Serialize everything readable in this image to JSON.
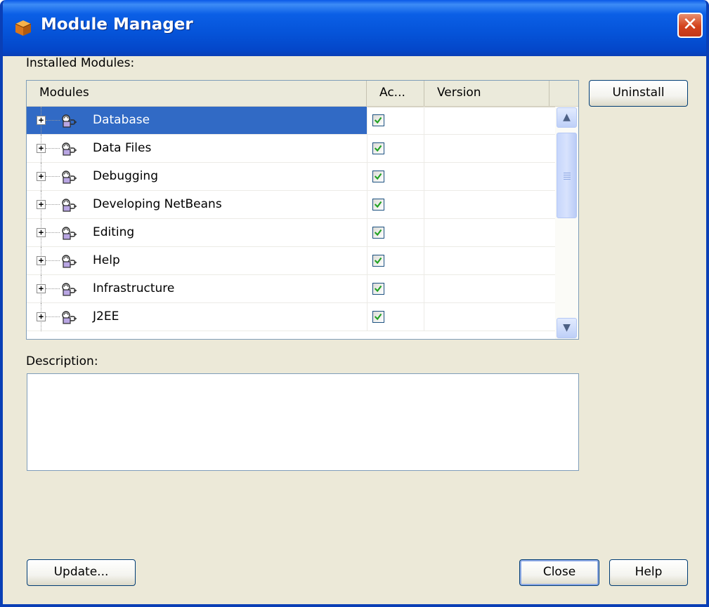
{
  "window": {
    "title": "Module Manager",
    "close_glyph": "✕",
    "icon": "netbeans-cube-icon"
  },
  "installed_label": "Installed Modules:",
  "table": {
    "columns": [
      "Modules",
      "Ac...",
      "Version"
    ],
    "rows": [
      {
        "name": "Database",
        "active": true,
        "version": "",
        "selected": true
      },
      {
        "name": "Data Files",
        "active": true,
        "version": ""
      },
      {
        "name": "Debugging",
        "active": true,
        "version": ""
      },
      {
        "name": "Developing NetBeans",
        "active": true,
        "version": ""
      },
      {
        "name": "Editing",
        "active": true,
        "version": ""
      },
      {
        "name": "Help",
        "active": true,
        "version": ""
      },
      {
        "name": "Infrastructure",
        "active": true,
        "version": ""
      },
      {
        "name": "J2EE",
        "active": true,
        "version": ""
      }
    ]
  },
  "description": {
    "label": "Description:",
    "value": ""
  },
  "buttons": {
    "uninstall": "Uninstall",
    "update": "Update...",
    "close": "Close",
    "help": "Help"
  },
  "colors": {
    "selection": "#316ac5",
    "title_bar": "#0553d8",
    "dialog_bg": "#ece9d8",
    "check": "#21a121"
  }
}
